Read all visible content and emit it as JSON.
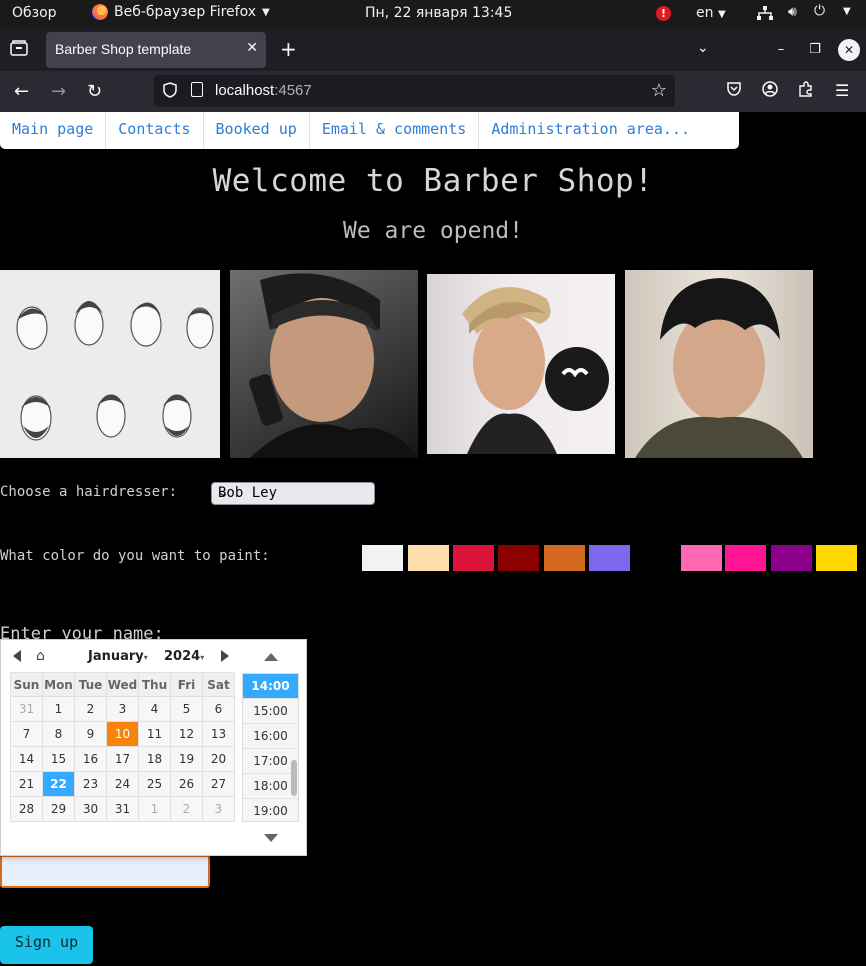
{
  "os": {
    "overview": "Обзор",
    "app_name": "Веб-браузер Firefox",
    "clock": "Пн, 22 января  13:45",
    "alert": "!",
    "lang": "en"
  },
  "browser": {
    "tab_title": "Barber Shop template",
    "url_host": "localhost",
    "url_port": ":4567"
  },
  "site": {
    "nav": [
      "Main page",
      "Contacts",
      "Booked up",
      "Email & comments",
      "Administration area..."
    ],
    "heading": "Welcome to Barber Shop!",
    "subheading": "We are opend!",
    "hairdresser_label": "Choose a hairdresser:",
    "hairdresser_selected": "Bob Ley",
    "color_label": "What color do you want to paint:",
    "colors": [
      "#f2f2f2",
      "#ffdead",
      "#dc143c",
      "#8b0000",
      "#d2691e",
      "#7b68ee",
      "#000000",
      "#ff69b4",
      "#ff1493",
      "#8b008b",
      "#ffd700"
    ],
    "name_label": "Enter your name:",
    "signup_label": "Sign up"
  },
  "datepicker": {
    "month": "January",
    "year": "2024",
    "weekdays": [
      "Sun",
      "Mon",
      "Tue",
      "Wed",
      "Thu",
      "Fri",
      "Sat"
    ],
    "weeks": [
      [
        "31",
        "1",
        "2",
        "3",
        "4",
        "5",
        "6"
      ],
      [
        "7",
        "8",
        "9",
        "10",
        "11",
        "12",
        "13"
      ],
      [
        "14",
        "15",
        "16",
        "17",
        "18",
        "19",
        "20"
      ],
      [
        "21",
        "22",
        "23",
        "24",
        "25",
        "26",
        "27"
      ],
      [
        "28",
        "29",
        "30",
        "31",
        "1",
        "2",
        "3"
      ]
    ],
    "times": [
      "14:00",
      "15:00",
      "16:00",
      "17:00",
      "18:00",
      "19:00"
    ]
  }
}
